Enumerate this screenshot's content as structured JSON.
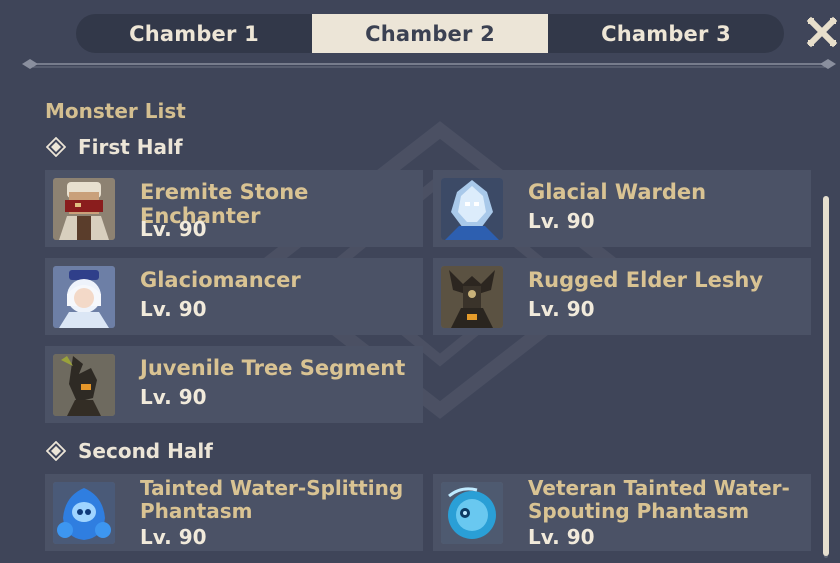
{
  "tabs": [
    {
      "label": "Chamber 1",
      "active": false
    },
    {
      "label": "Chamber 2",
      "active": true
    },
    {
      "label": "Chamber 3",
      "active": false
    }
  ],
  "icons": {
    "close": "close-x-icon",
    "section_marker": "diamond-icon"
  },
  "colors": {
    "background": "#3f4559",
    "card": "#4b5266",
    "accent_gold": "#d4bf90",
    "tab_active": "#ece5d7"
  },
  "monster_list": {
    "title": "Monster List",
    "first_half": {
      "heading": "First Half",
      "monsters": [
        {
          "name": "Eremite Stone Enchanter",
          "level": "Lv. 90"
        },
        {
          "name": "Glacial Warden",
          "level": "Lv. 90"
        },
        {
          "name": "Glaciomancer",
          "level": "Lv. 90"
        },
        {
          "name": "Rugged Elder Leshy",
          "level": "Lv. 90"
        },
        {
          "name": "Juvenile Tree Segment",
          "level": "Lv. 90"
        }
      ]
    },
    "second_half": {
      "heading": "Second Half",
      "monsters": [
        {
          "name": "Tainted Water-Splitting Phantasm",
          "level": "Lv. 90"
        },
        {
          "name": "Veteran Tainted Water-Spouting Phantasm",
          "level": "Lv. 90"
        }
      ]
    }
  }
}
